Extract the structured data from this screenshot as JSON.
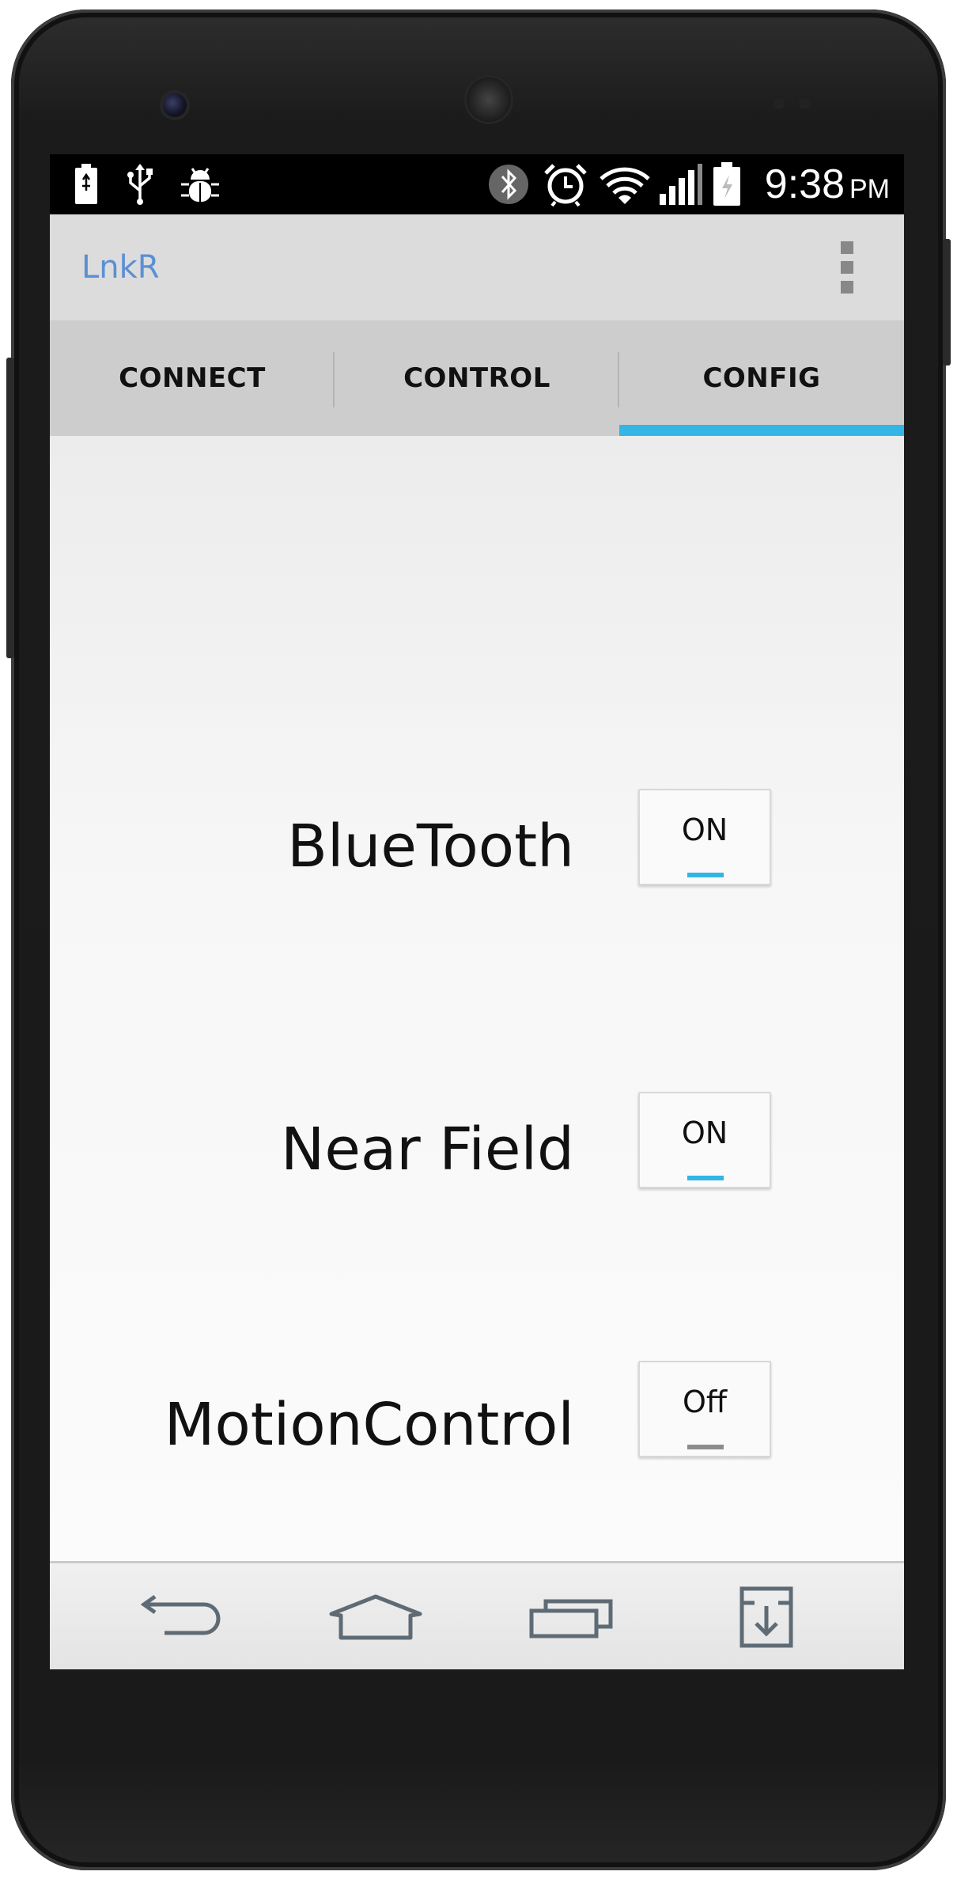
{
  "status_bar": {
    "time": "9:38",
    "ampm": "PM",
    "left_icons": [
      "battery-icon",
      "usb-icon",
      "bug-icon"
    ],
    "right_icons": [
      "bluetooth-icon",
      "alarm-icon",
      "wifi-icon",
      "signal-icon",
      "battery-charging-icon"
    ]
  },
  "action_bar": {
    "title": "LnkR",
    "title_color": "#5b8fd6",
    "menu_icon": "overflow-menu-icon"
  },
  "tabs": [
    {
      "label": "CONNECT",
      "selected": false
    },
    {
      "label": "CONTROL",
      "selected": false
    },
    {
      "label": "CONFIG",
      "selected": true
    }
  ],
  "accent_color": "#33b5e5",
  "settings": [
    {
      "label": "BlueTooth",
      "state": "ON",
      "enabled": true
    },
    {
      "label": "Near Field",
      "state": "ON",
      "enabled": true
    },
    {
      "label": "MotionControl",
      "state": "Off",
      "enabled": false
    }
  ],
  "nav_bar": {
    "buttons": [
      "back-icon",
      "home-icon",
      "recents-icon",
      "download-icon"
    ]
  }
}
